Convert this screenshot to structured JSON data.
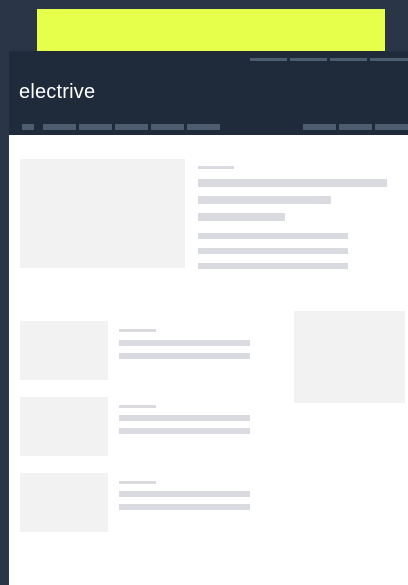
{
  "site": {
    "logo": "electrive"
  },
  "colors": {
    "page_bg": "#2a3547",
    "banner": "#e5ff4a",
    "header_bg": "#1f2a3a",
    "placeholder_block": "#f2f2f2",
    "placeholder_line": "#d9dbe0",
    "nav_placeholder": "#4e5c70"
  },
  "state": "loading skeleton placeholders (no text rendered)"
}
